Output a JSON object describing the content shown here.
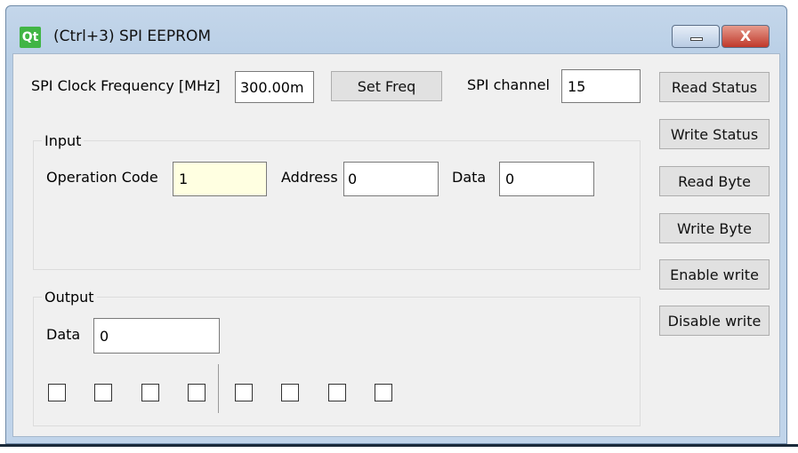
{
  "window": {
    "title": "(Ctrl+3) SPI EEPROM",
    "logo": "Qt",
    "close_glyph": "X"
  },
  "top": {
    "freq_label": "SPI Clock Frequency [MHz]",
    "freq_value": "300.00m",
    "set_freq": "Set Freq",
    "channel_label": "SPI channel",
    "channel_value": "15"
  },
  "side_buttons": [
    "Read Status",
    "Write Status",
    "Read Byte",
    "Write Byte",
    "Enable write",
    "Disable write"
  ],
  "input": {
    "title": "Input",
    "opcode_label": "Operation Code",
    "opcode_value": "1",
    "address_label": "Address",
    "address_value": "0",
    "data_label": "Data",
    "data_value": "0"
  },
  "output": {
    "title": "Output",
    "data_label": "Data",
    "data_value": "0",
    "bits": [
      false,
      false,
      false,
      false,
      false,
      false,
      false,
      false
    ]
  }
}
